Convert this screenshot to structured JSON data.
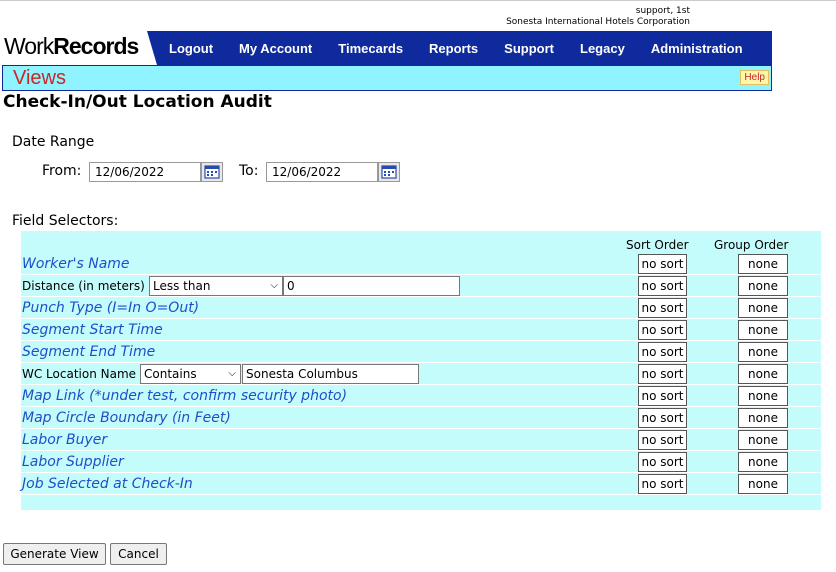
{
  "header": {
    "user_line1": "support, 1st",
    "user_line2": "Sonesta International Hotels Corporation",
    "logo_work": "Work",
    "logo_records": "Records"
  },
  "nav": {
    "items": [
      "Logout",
      "My Account",
      "Timecards",
      "Reports",
      "Support",
      "Legacy",
      "Administration"
    ]
  },
  "views_bar": {
    "title": "Views",
    "help": "Help"
  },
  "page_title": "Check-In/Out Location Audit",
  "date_range": {
    "label": "Date Range",
    "from_label": "From:",
    "from_value": "12/06/2022",
    "to_label": "To:",
    "to_value": "12/06/2022"
  },
  "field_selectors": {
    "label": "Field Selectors:",
    "sort_header": "Sort Order",
    "group_header": "Group Order",
    "rows": [
      {
        "name": "Worker's Name",
        "sort": "no sort",
        "group": "none"
      },
      {
        "name": "Distance (in meters)",
        "operator": "Less than",
        "value": "0",
        "sort": "no sort",
        "group": "none"
      },
      {
        "name": "Punch Type (I=In O=Out)",
        "sort": "no sort",
        "group": "none"
      },
      {
        "name": "Segment Start Time",
        "sort": "no sort",
        "group": "none"
      },
      {
        "name": "Segment End Time",
        "sort": "no sort",
        "group": "none"
      },
      {
        "name": "WC Location Name",
        "operator": "Contains",
        "value": "Sonesta Columbus",
        "sort": "no sort",
        "group": "none"
      },
      {
        "name": "Map Link (*under test, confirm security photo)",
        "sort": "no sort",
        "group": "none"
      },
      {
        "name": "Map Circle Boundary (in Feet)",
        "sort": "no sort",
        "group": "none"
      },
      {
        "name": "Labor Buyer",
        "sort": "no sort",
        "group": "none"
      },
      {
        "name": "Labor Supplier",
        "sort": "no sort",
        "group": "none"
      },
      {
        "name": "Job Selected at Check-In",
        "sort": "no sort",
        "group": "none"
      }
    ]
  },
  "actions": {
    "generate": "Generate View",
    "cancel": "Cancel"
  },
  "colors": {
    "nav_bg": "#0e2a9c",
    "views_bg": "#8ff4ff",
    "field_bg": "#c4fcfc",
    "field_link": "#1f4fc8",
    "views_title": "#c62828"
  },
  "icons": {
    "calendar": "calendar-icon"
  }
}
